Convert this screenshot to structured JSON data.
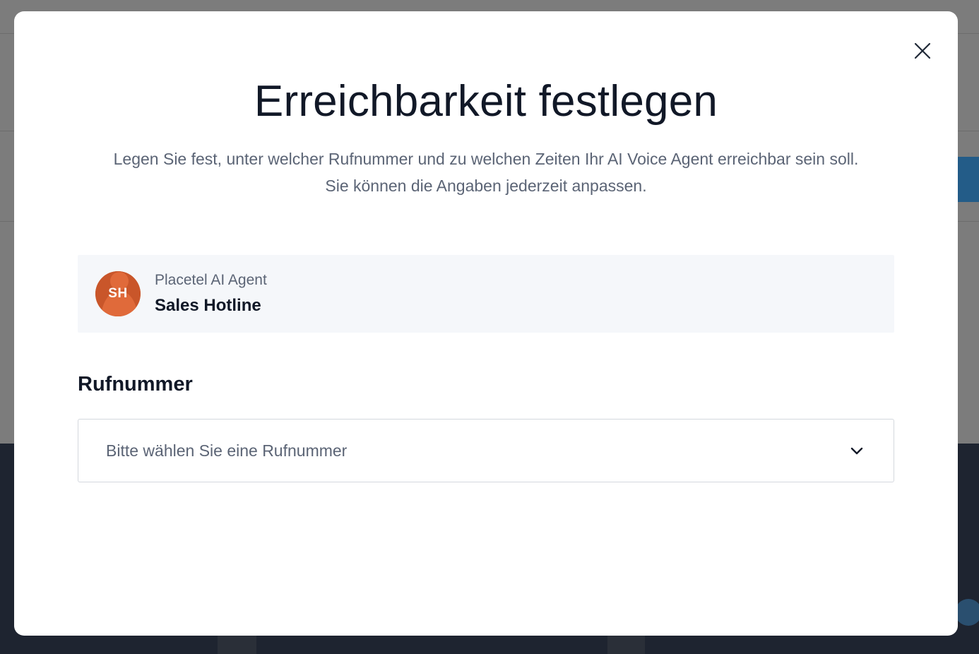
{
  "modal": {
    "title": "Erreichbarkeit festlegen",
    "subtitle_line1": "Legen Sie fest, unter welcher Rufnummer und zu welchen Zeiten Ihr AI Voice Agent erreichbar sein soll.",
    "subtitle_line2": "Sie können die Angaben jederzeit anpassen.",
    "close_icon": "close-icon"
  },
  "agent": {
    "avatar_initials": "SH",
    "avatar_color": "#c9562a",
    "type": "Placetel AI Agent",
    "name": "Sales Hotline"
  },
  "phone_section": {
    "label": "Rufnummer",
    "select_placeholder": "Bitte wählen Sie eine Rufnummer",
    "chevron_icon": "chevron-down-icon"
  }
}
